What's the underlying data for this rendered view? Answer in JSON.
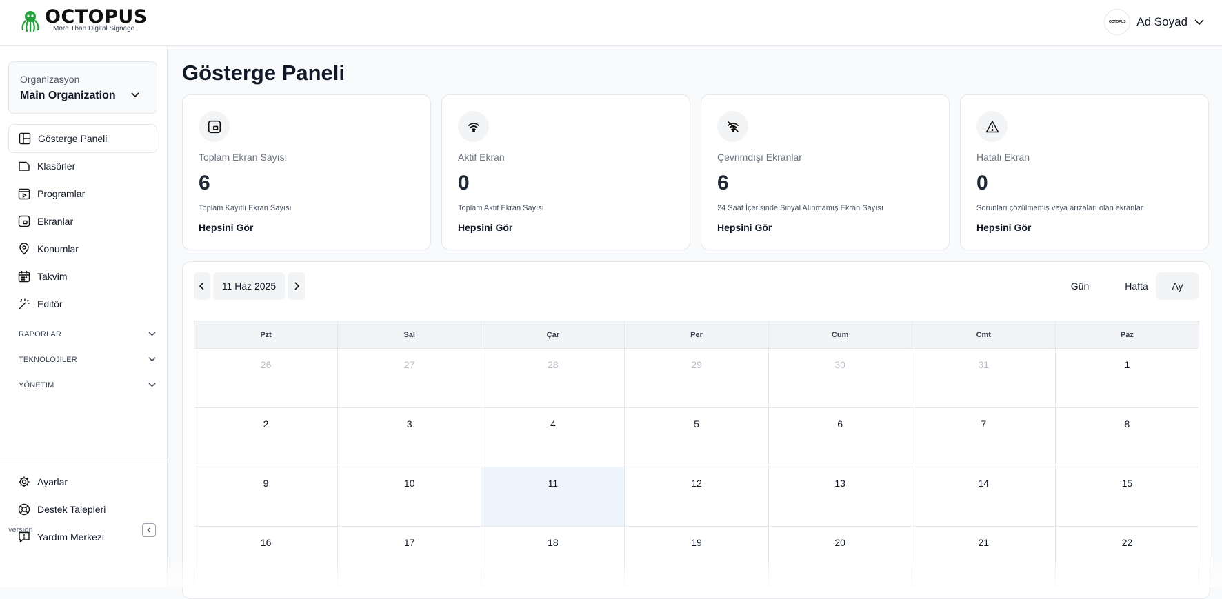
{
  "header": {
    "logo_name": "OCTOPUS",
    "logo_tagline": "More Than Digital Signage",
    "avatar_text": "OCTOPUS",
    "user_name": "Ad Soyad"
  },
  "sidebar": {
    "org_label": "Organizasyon",
    "org_name": "Main Organization",
    "items": [
      {
        "label": "Gösterge Paneli",
        "icon": "dashboard-icon",
        "active": true
      },
      {
        "label": "Klasörler",
        "icon": "folder-icon"
      },
      {
        "label": "Programlar",
        "icon": "program-icon"
      },
      {
        "label": "Ekranlar",
        "icon": "screen-icon"
      },
      {
        "label": "Konumlar",
        "icon": "map-pin-icon"
      },
      {
        "label": "Takvim",
        "icon": "calendar-icon"
      },
      {
        "label": "Editör",
        "icon": "magic-wand-icon"
      }
    ],
    "sections": [
      "RAPORLAR",
      "TEKNOLOJILER",
      "YÖNETIM"
    ],
    "bottom_items": [
      {
        "label": "Ayarlar",
        "icon": "gear-icon"
      },
      {
        "label": "Destek Talepleri",
        "icon": "lifebuoy-icon"
      },
      {
        "label": "Yardım Merkezi",
        "icon": "help-chat-icon"
      }
    ],
    "version": "version"
  },
  "main": {
    "title": "Gösterge Paneli",
    "cards": [
      {
        "label": "Toplam Ekran Sayısı",
        "value": "6",
        "desc": "Toplam Kayıtlı Ekran Sayısı",
        "link": "Hepsini Gör",
        "icon": "screen-icon"
      },
      {
        "label": "Aktif Ekran",
        "value": "0",
        "desc": "Toplam Aktif Ekran Sayısı",
        "link": "Hepsini Gör",
        "icon": "wifi-icon"
      },
      {
        "label": "Çevrimdışı Ekranlar",
        "value": "6",
        "desc": "24 Saat İçerisinde Sinyal Alınmamış Ekran Sayısı",
        "link": "Hepsini Gör",
        "icon": "wifi-off-icon"
      },
      {
        "label": "Hatalı Ekran",
        "value": "0",
        "desc": "Sorunları çözülmemiş veya arızaları olan ekranlar",
        "link": "Hepsini Gör",
        "icon": "warning-icon"
      }
    ]
  },
  "calendar": {
    "current_date": "11 Haz 2025",
    "views": [
      "Gün",
      "Hafta",
      "Ay"
    ],
    "selected_view": "Ay",
    "weekdays": [
      "Pzt",
      "Sal",
      "Çar",
      "Per",
      "Cum",
      "Cmt",
      "Paz"
    ],
    "weeks": [
      [
        "26",
        "27",
        "28",
        "29",
        "30",
        "31",
        "1"
      ],
      [
        "2",
        "3",
        "4",
        "5",
        "6",
        "7",
        "8"
      ],
      [
        "9",
        "10",
        "11",
        "12",
        "13",
        "14",
        "15"
      ],
      [
        "16",
        "17",
        "18",
        "19",
        "20",
        "21",
        "22"
      ]
    ],
    "today": "11"
  },
  "colors": {
    "brand_green": "#22a33a",
    "today_bg": "#eef5fd",
    "muted_day": "#b8bec8"
  }
}
